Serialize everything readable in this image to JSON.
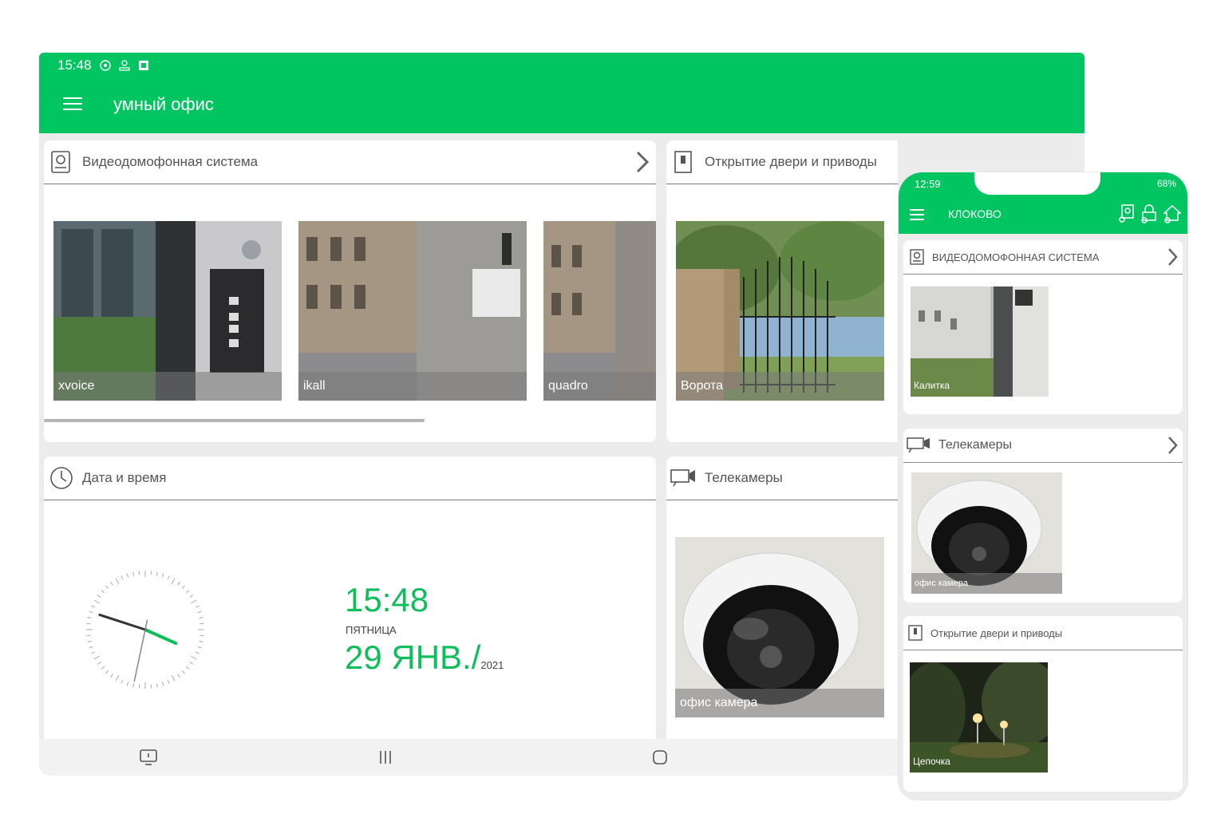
{
  "tablet": {
    "status_time": "15:48",
    "app_title": "умный офис",
    "video_intercom": {
      "title": "Видеодомофонная система",
      "items": [
        {
          "label": "xvoice"
        },
        {
          "label": "ikall"
        },
        {
          "label": "quadro"
        }
      ]
    },
    "doors": {
      "title": "Открытие двери и приводы",
      "items": [
        {
          "label": "Ворота"
        }
      ]
    },
    "datetime": {
      "title": "Дата и время",
      "time": "15:48",
      "weekday": "ПЯТНИЦА",
      "date": "29 ЯНВ./",
      "year": "2021"
    },
    "cameras": {
      "title": "Телекамеры",
      "items": [
        {
          "label": "офис камера"
        }
      ]
    }
  },
  "phone": {
    "status_time": "12:59",
    "status_right": "68%",
    "app_title": "КЛОКОВО",
    "video_intercom": {
      "title": "ВИДЕОДОМОФОННАЯ СИСТЕМА",
      "items": [
        {
          "label": "Калитка"
        }
      ]
    },
    "cameras": {
      "title": "Телекамеры",
      "items": [
        {
          "label": "офис камера"
        }
      ]
    },
    "doors": {
      "title": "Открытие двери и приводы",
      "items": [
        {
          "label": "Цепочка"
        }
      ]
    }
  },
  "colors": {
    "brand_green": "#00c561",
    "clock_green": "#0fbd5a"
  }
}
